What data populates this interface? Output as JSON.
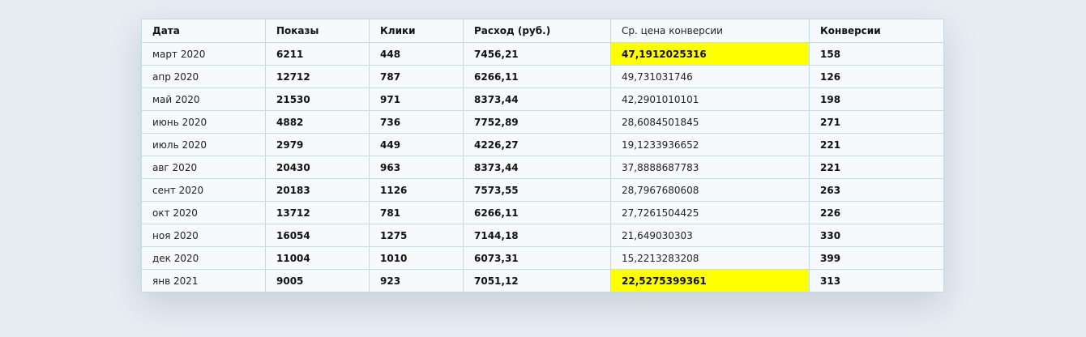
{
  "table": {
    "headers": [
      "Дата",
      "Показы",
      "Клики",
      "Расход (руб.)",
      "Ср. цена конверсии",
      "Конверсии"
    ],
    "rows": [
      [
        "март 2020",
        "6211",
        "448",
        "7456,21",
        "47,1912025316",
        "158"
      ],
      [
        "апр 2020",
        "12712",
        "787",
        "6266,11",
        "49,731031746",
        "126"
      ],
      [
        "май 2020",
        "21530",
        "971",
        "8373,44",
        "42,2901010101",
        "198"
      ],
      [
        "июнь 2020",
        "4882",
        "736",
        "7752,89",
        "28,6084501845",
        "271"
      ],
      [
        "июль 2020",
        "2979",
        "449",
        "4226,27",
        "19,1233936652",
        "221"
      ],
      [
        "авг 2020",
        "20430",
        "963",
        "8373,44",
        "37,8888687783",
        "221"
      ],
      [
        "сент 2020",
        "20183",
        "1126",
        "7573,55",
        "28,7967680608",
        "263"
      ],
      [
        "окт 2020",
        "13712",
        "781",
        "6266,11",
        "27,7261504425",
        "226"
      ],
      [
        "ноя 2020",
        "16054",
        "1275",
        "7144,18",
        "21,649030303",
        "330"
      ],
      [
        "дек 2020",
        "11004",
        "1010",
        "6073,31",
        "15,2213283208",
        "399"
      ],
      [
        "янв 2021",
        "9005",
        "923",
        "7051,12",
        "22,5275399361",
        "313"
      ]
    ],
    "highlighted_rows": [
      0,
      10
    ],
    "highlight_color": "#ffff00"
  }
}
